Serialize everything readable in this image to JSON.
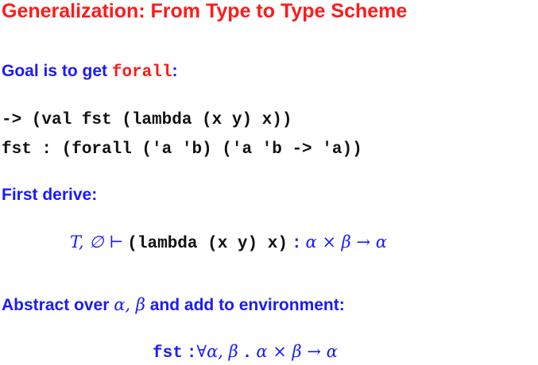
{
  "title": "Generalization: From Type to Type Scheme",
  "goal": {
    "prefix": "Goal is to get ",
    "keyword": "forall",
    "suffix": ":"
  },
  "code_lines": [
    "-> (val fst (lambda (x y) x))",
    "fst : (forall ('a 'b) ('a 'b -> 'a))"
  ],
  "first_derive": {
    "heading": "First derive:",
    "lhs": "T, ∅ ⊢",
    "expr": "(lambda (x y) x)",
    "colon": ":",
    "type": "α × β → α"
  },
  "abstract": {
    "prefix": "Abstract over ",
    "vars": "α, β",
    "suffix": " and add to environment:"
  },
  "final": {
    "name": "fst",
    "colon": ":",
    "scheme": "∀α, β",
    "dot": ".",
    "body": "α × β → α"
  }
}
